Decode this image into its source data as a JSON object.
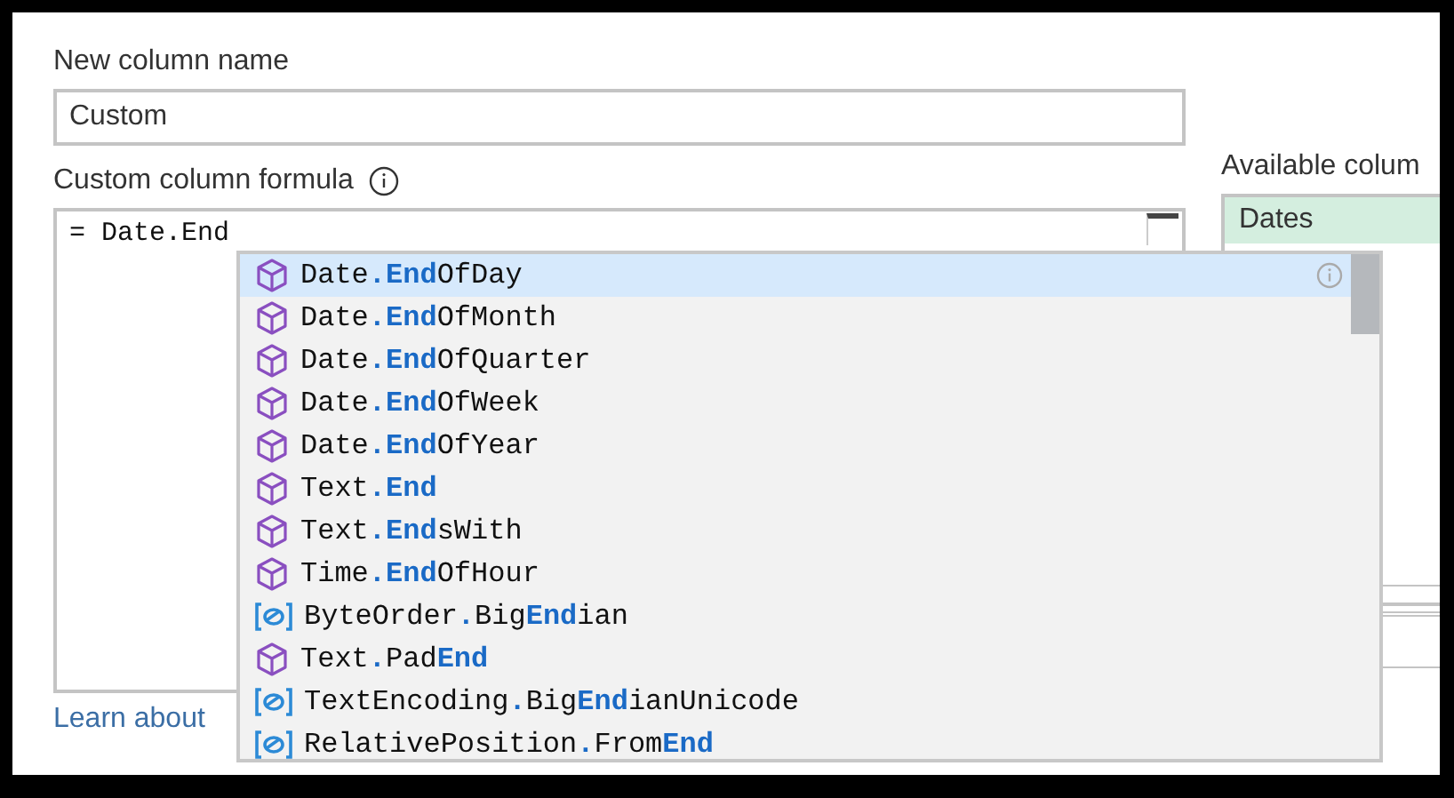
{
  "name_field": {
    "label": "New column name",
    "value": "Custom"
  },
  "formula": {
    "label": "Custom column formula",
    "value": "= Date.End"
  },
  "learn_link": "Learn about",
  "available_columns": {
    "label": "Available colum",
    "items": [
      {
        "label": "Dates",
        "selected": true
      }
    ]
  },
  "suggestions": [
    {
      "kind": "function",
      "label": "Date**.End**OfDay",
      "selected": true
    },
    {
      "kind": "function",
      "label": "Date**.End**OfMonth",
      "selected": false
    },
    {
      "kind": "function",
      "label": "Date**.End**OfQuarter",
      "selected": false
    },
    {
      "kind": "function",
      "label": "Date**.End**OfWeek",
      "selected": false
    },
    {
      "kind": "function",
      "label": "Date**.End**OfYear",
      "selected": false
    },
    {
      "kind": "function",
      "label": "Text**.End**",
      "selected": false
    },
    {
      "kind": "function",
      "label": "Text**.End**sWith",
      "selected": false
    },
    {
      "kind": "function",
      "label": "Time**.End**OfHour",
      "selected": false
    },
    {
      "kind": "constant",
      "label": "ByteOrder**.**Big**End**ian",
      "selected": false
    },
    {
      "kind": "function",
      "label": "Text**.**Pad**End**",
      "selected": false
    },
    {
      "kind": "constant",
      "label": "TextEncoding**.**Big**End**ianUnicode",
      "selected": false
    },
    {
      "kind": "constant",
      "label": "RelativePosition**.**From**End**",
      "selected": false
    }
  ]
}
